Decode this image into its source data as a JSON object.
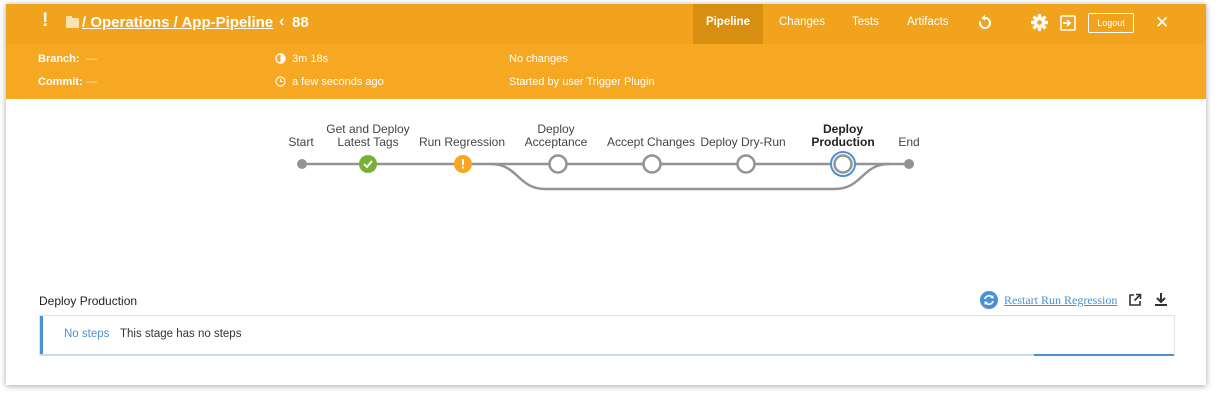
{
  "header": {
    "status_icon": "!",
    "breadcrumb": "/ Operations / App-Pipeline",
    "back_chevron": "‹",
    "run_number": "88",
    "tabs": [
      {
        "label": "Pipeline"
      },
      {
        "label": "Changes"
      },
      {
        "label": "Tests"
      },
      {
        "label": "Artifacts"
      }
    ],
    "logout_label": "Logout",
    "close_icon": "✕",
    "accent": "#f1a31d"
  },
  "run": {
    "branch_label": "Branch:",
    "branch_value": "—",
    "commit_label": "Commit:",
    "commit_value": "—",
    "duration": "3m 18s",
    "started": "a few seconds ago",
    "changes": "No changes",
    "cause": "Started by user Trigger Plugin"
  },
  "pipeline": {
    "stages": [
      {
        "name": "Start",
        "status": "start"
      },
      {
        "name": "Get and Deploy Latest Tags",
        "line1": "Get and Deploy",
        "line2": "Latest Tags",
        "status": "success"
      },
      {
        "name": "Run Regression",
        "status": "unstable"
      },
      {
        "name": "Deploy Acceptance",
        "line1": "Deploy",
        "line2": "Acceptance",
        "status": "not_built"
      },
      {
        "name": "Accept Changes",
        "status": "not_built"
      },
      {
        "name": "Deploy Dry-Run",
        "status": "not_built"
      },
      {
        "name": "Deploy Production",
        "line1": "Deploy",
        "line2": "Production",
        "status": "selected"
      },
      {
        "name": "End",
        "status": "end"
      }
    ]
  },
  "detail": {
    "title": "Deploy Production",
    "restart_label": "Restart Run Regression",
    "no_steps_label": "No steps",
    "no_steps_message": "This stage has no steps"
  }
}
